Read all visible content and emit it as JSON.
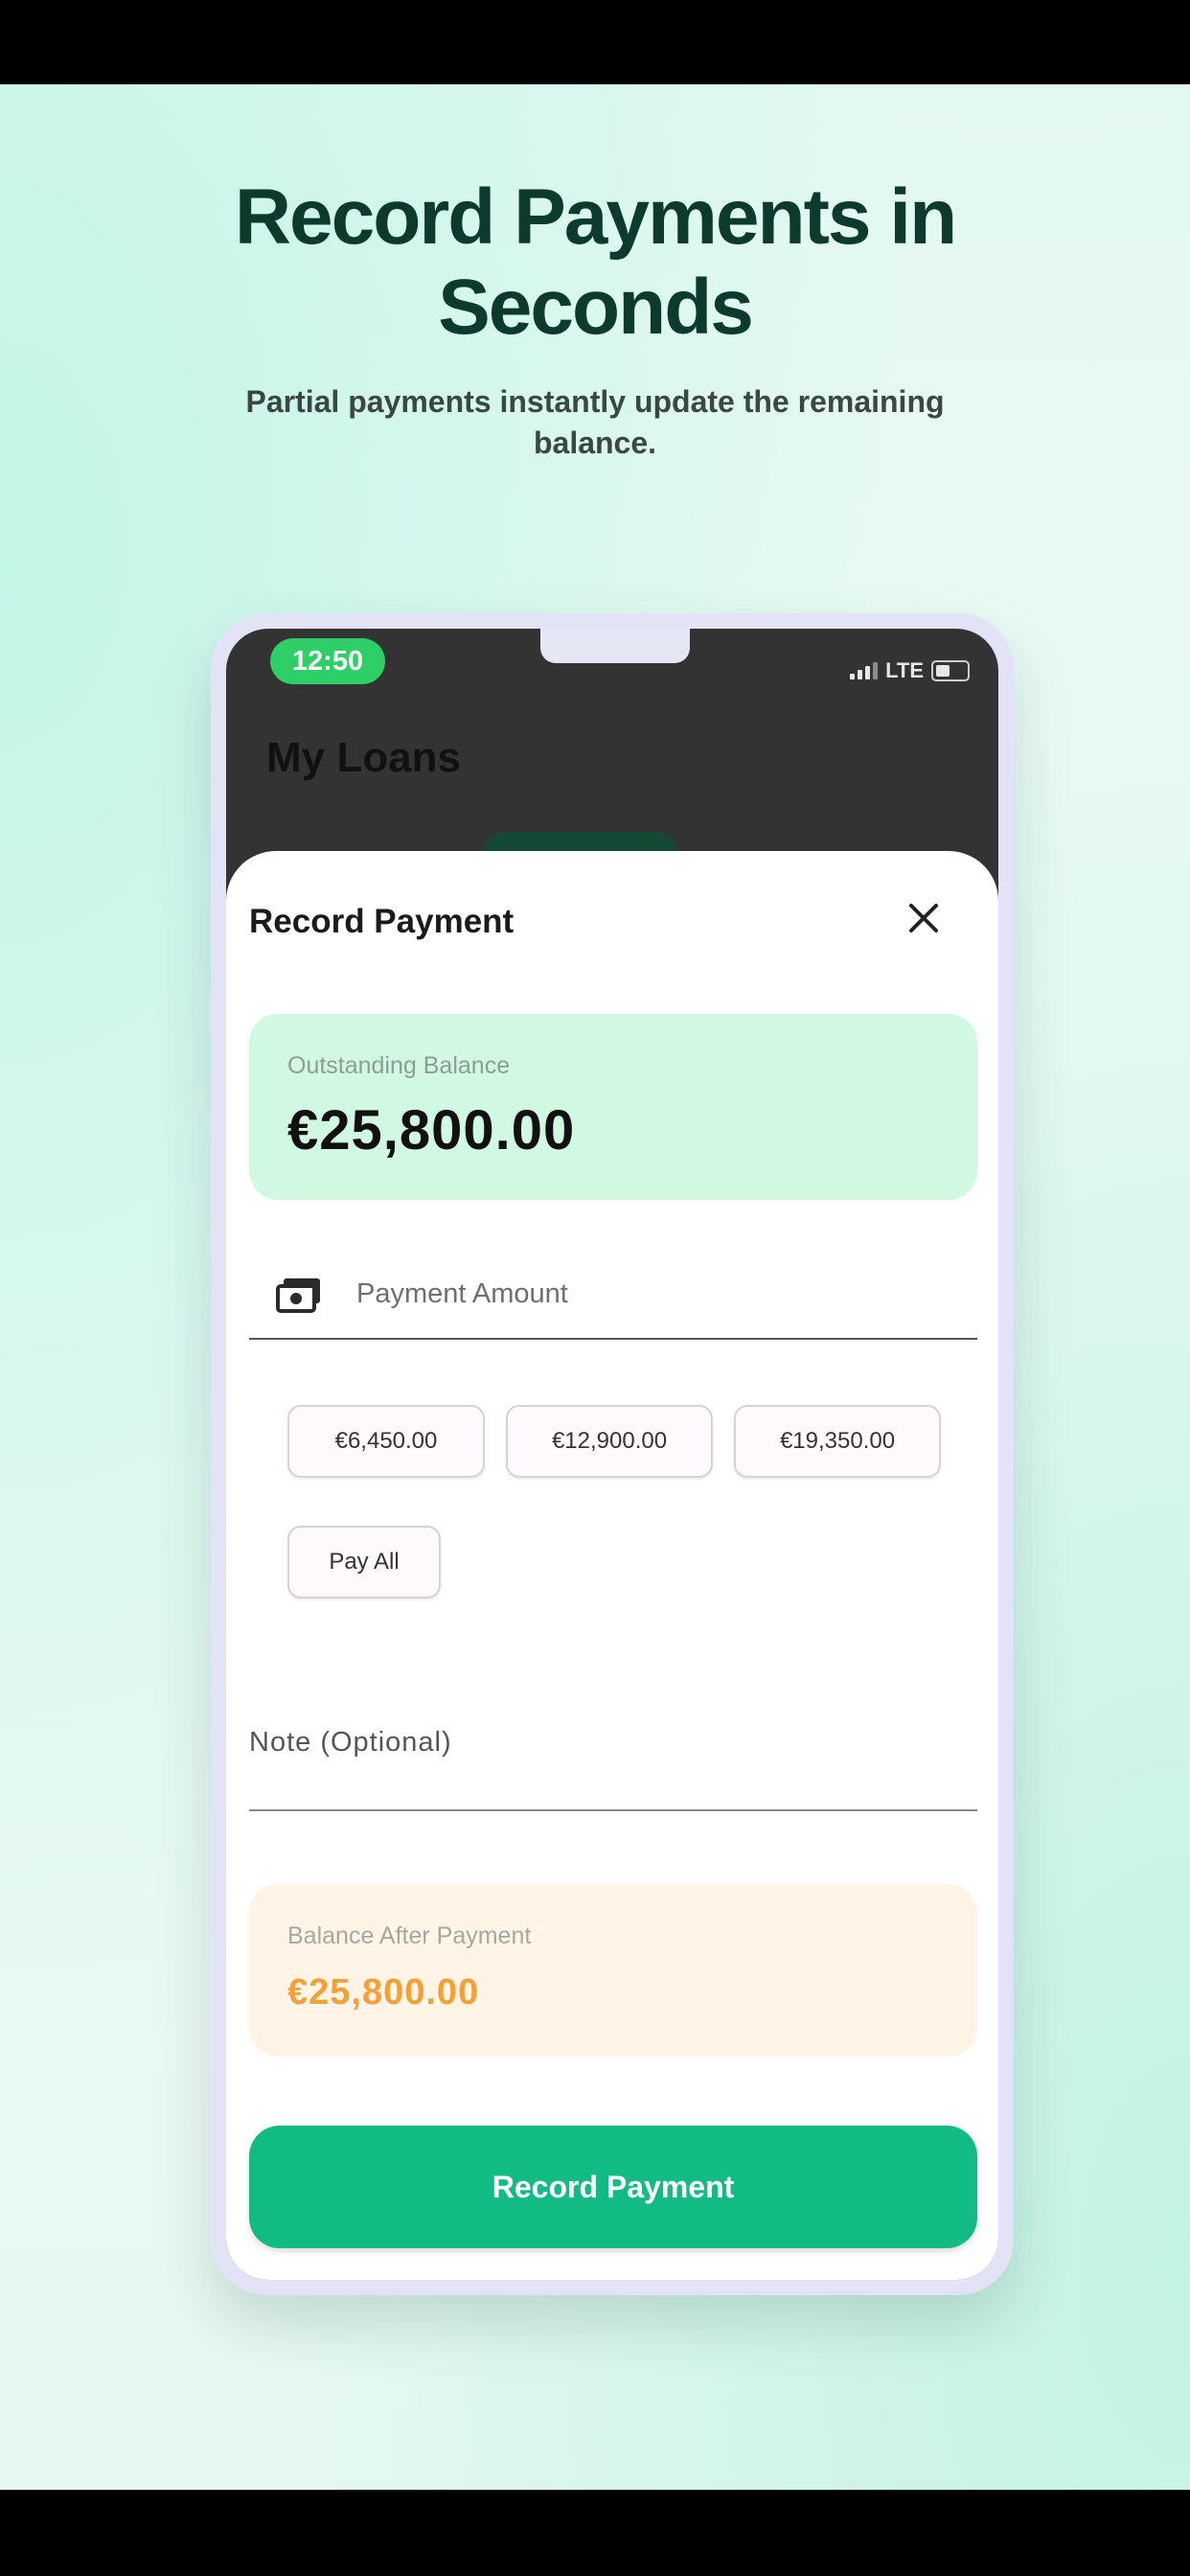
{
  "promo": {
    "headline_line1": "Record Payments in",
    "headline_line2": "Seconds",
    "subhead": "Partial payments instantly update the remaining balance."
  },
  "status_bar": {
    "time": "12:50",
    "network": "LTE"
  },
  "background_screen": {
    "title": "My Loans"
  },
  "sheet": {
    "title": "Record Payment",
    "close_icon": "close-icon",
    "outstanding": {
      "label": "Outstanding Balance",
      "value": "€25,800.00"
    },
    "payment_amount": {
      "placeholder": "Payment Amount",
      "icon": "cash-icon"
    },
    "quick_amounts": [
      "€6,450.00",
      "€12,900.00",
      "€19,350.00"
    ],
    "pay_all_label": "Pay All",
    "note_label": "Note (Optional)",
    "balance_after": {
      "label": "Balance After Payment",
      "value": "€25,800.00"
    },
    "submit_label": "Record Payment"
  },
  "colors": {
    "headline": "#0c3b2d",
    "accent_green": "#11bb83",
    "status_pill": "#2ecf66",
    "balance_card": "#d1f8e1",
    "after_card": "#fff4e6",
    "after_value": "#f4a038"
  }
}
